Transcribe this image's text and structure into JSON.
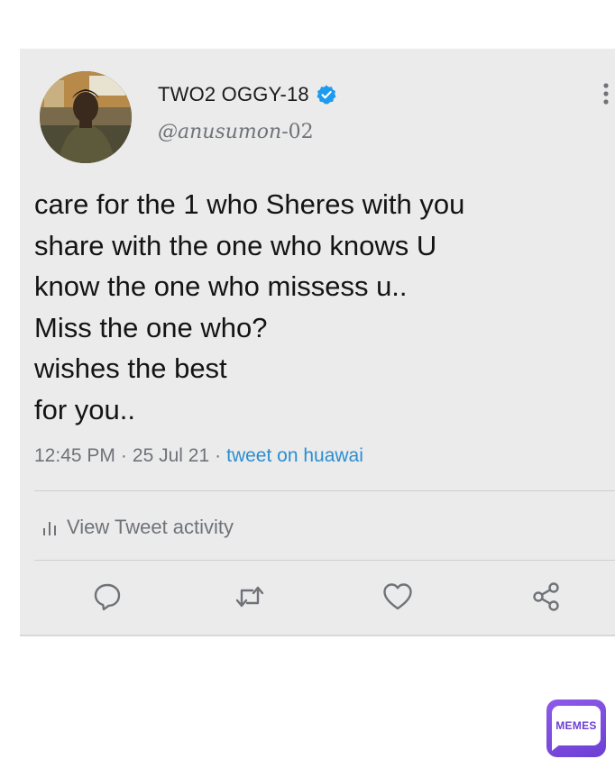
{
  "tweet": {
    "display_name": "TWO2 OGGY-18",
    "handle_prefix": "@anusumon",
    "handle_suffix": "-02",
    "verified": true,
    "text_lines": [
      "care for the 1 who Sheres with you",
      "share with the one who knows U",
      "know the one who missess u..",
      "Miss the one who?",
      "wishes the best",
      "for you.."
    ],
    "time": "12:45 PM",
    "date": "25 Jul 21",
    "separator": "·",
    "source": "tweet on huawai"
  },
  "activity": {
    "label": "View Tweet activity"
  },
  "icons": {
    "reply": "reply-icon",
    "retweet": "retweet-icon",
    "like": "like-icon",
    "share": "share-icon",
    "more": "more-vertical-icon",
    "verified": "verified-badge-icon",
    "activity": "bar-chart-icon"
  },
  "watermark": {
    "label": "MEMES"
  },
  "colors": {
    "card_background": "#ebebeb",
    "link_blue": "#2a8ed1",
    "verified_blue": "#1d9bf0",
    "secondary_text": "#6f7378",
    "watermark_purple": "#7a4ae0"
  }
}
